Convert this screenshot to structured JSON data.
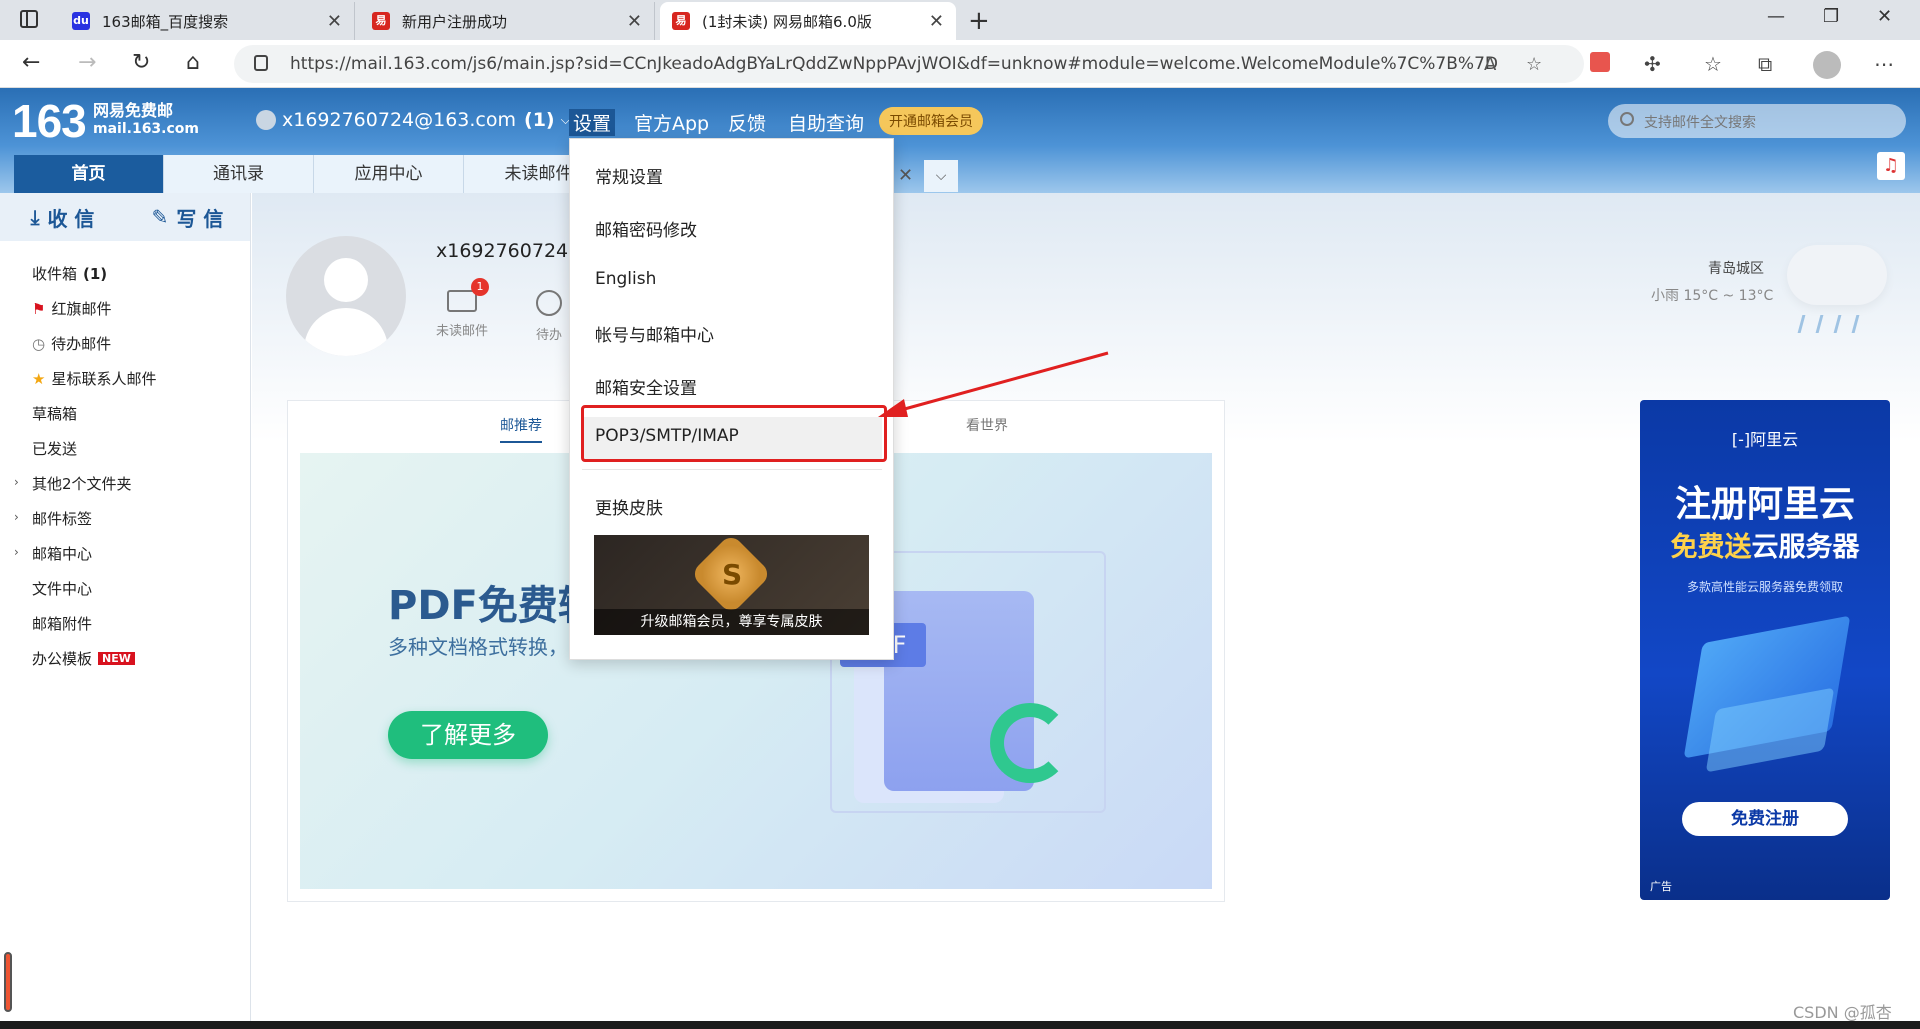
{
  "browser": {
    "tabs": [
      {
        "title": "163邮箱_百度搜索",
        "favicon": "baidu-paw",
        "favicon_text": "du"
      },
      {
        "title": "新用户注册成功",
        "favicon": "netease-163",
        "favicon_text": "易"
      },
      {
        "title": "(1封未读) 网易邮箱6.0版",
        "favicon": "netease-163",
        "favicon_text": "易"
      }
    ],
    "url": "https://mail.163.com/js6/main.jsp?sid=CCnJkeadoAdgBYaLrQddZwNppPAvjWOI&df=unknow#module=welcome.WelcomeModule%7C%7B%7D",
    "reader_glyph": "A",
    "fav_glyph": "☆"
  },
  "header": {
    "logo_num": "163",
    "logo_line1": "网易免费邮",
    "logo_line2": "mail.163.com",
    "account": "x1692760724@163.com",
    "account_unread": "(1)",
    "nav": [
      "设置",
      "官方App",
      "反馈",
      "自助查询"
    ],
    "vip_label": "开通邮箱会员",
    "search_placeholder": "支持邮件全文搜索",
    "tabs": [
      "首页",
      "通讯录",
      "应用中心",
      "未读邮件"
    ],
    "music_glyph": "♫"
  },
  "sidebar": {
    "receive_label": "收 信",
    "write_label": "写 信",
    "folders": [
      {
        "label": "收件箱",
        "count": "(1)",
        "icon": ""
      },
      {
        "label": "红旗邮件",
        "icon": "flag-icon",
        "glyph": "⚑"
      },
      {
        "label": "待办邮件",
        "icon": "clock-icon",
        "glyph": "◷"
      },
      {
        "label": "星标联系人邮件",
        "icon": "star-icon",
        "glyph": "★"
      },
      {
        "label": "草稿箱"
      },
      {
        "label": "已发送"
      },
      {
        "label": "其他2个文件夹"
      },
      {
        "label": "邮件标签"
      },
      {
        "label": "邮箱中心"
      },
      {
        "label": "文件中心"
      },
      {
        "label": "邮箱附件"
      },
      {
        "label": "办公模板",
        "badge": "NEW"
      }
    ]
  },
  "welcome": {
    "username": "x1692760724,",
    "unread_count": "1",
    "unread_label": "未读邮件",
    "todo_label": "待办",
    "weather_city": "青岛城区",
    "weather_desc": "小雨 15°C ~ 13°C"
  },
  "card": {
    "tabs": [
      "邮推荐",
      "看世界"
    ],
    "banner_title": "PDF免费转",
    "banner_sub": "多种文档格式转换，",
    "banner_button": "了解更多",
    "pdf_label": "PDF"
  },
  "ad": {
    "logo": "[-]阿里云",
    "title": "注册阿里云",
    "subtitle_a": "免费送",
    "subtitle_b": "云服务器",
    "desc": "多款高性能云服务器免费领取",
    "cta": "免费注册",
    "tag": "广告"
  },
  "dropdown": {
    "items": [
      "常规设置",
      "邮箱密码修改",
      "English",
      "帐号与邮箱中心",
      "邮箱安全设置",
      "POP3/SMTP/IMAP",
      "更换皮肤"
    ],
    "promo_text": "升级邮箱会员，尊享专属皮肤"
  },
  "watermark": "CSDN @孤杏",
  "colors": {
    "brand_blue": "#1b5c9e",
    "highlight_red": "#e02020",
    "vip_yellow": "#f5c75b"
  }
}
